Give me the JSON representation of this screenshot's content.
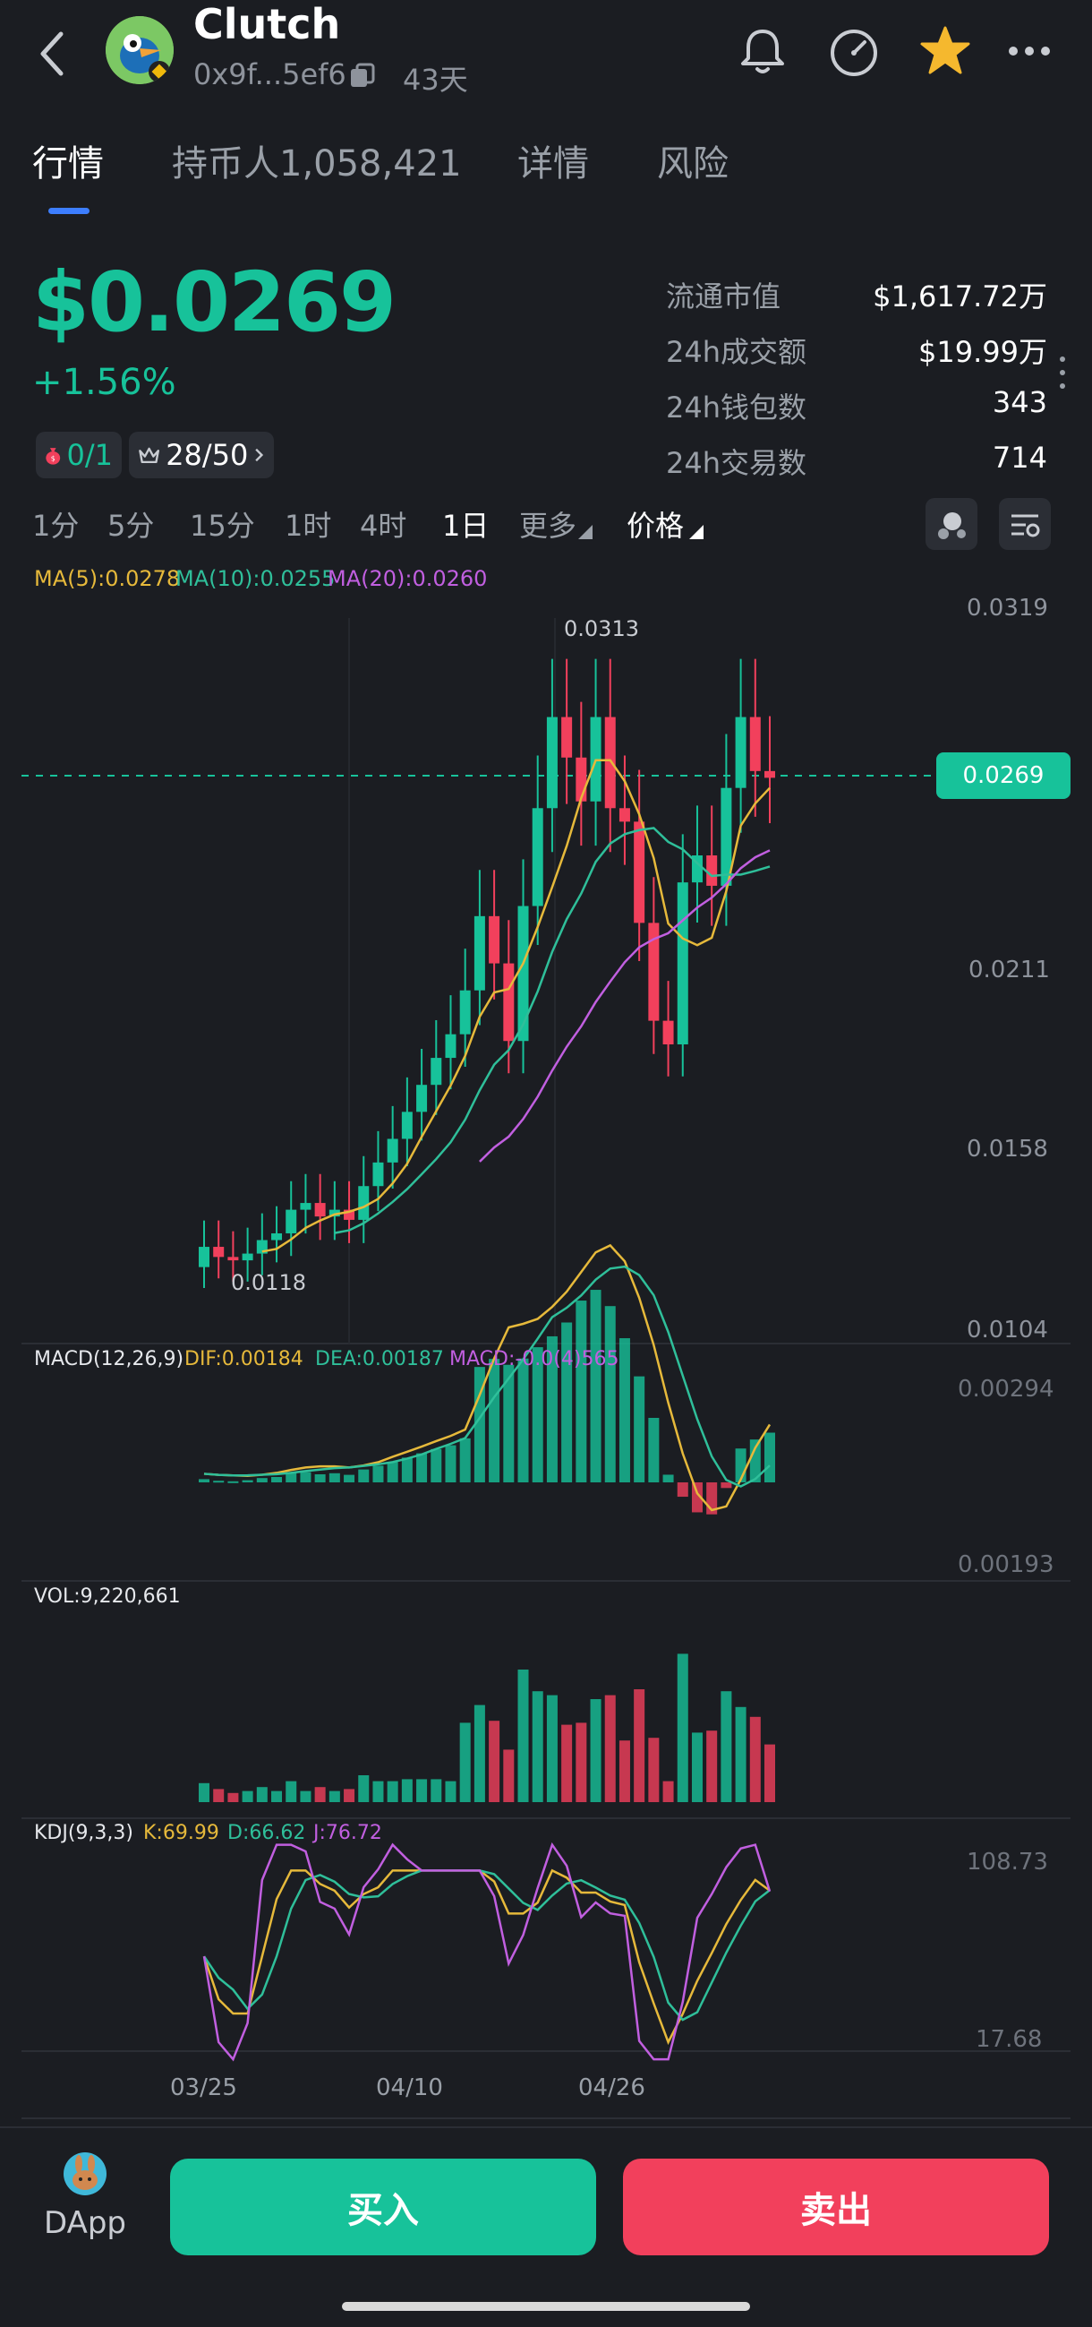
{
  "header": {
    "title": "Clutch",
    "address": "0x9f...5ef6",
    "age": "43天"
  },
  "tabs": [
    {
      "label": "行情"
    },
    {
      "label": "持币人1,058,421"
    },
    {
      "label": "详情"
    },
    {
      "label": "风险"
    }
  ],
  "price": "$0.0269",
  "change": "+1.56%",
  "chips": {
    "a": "0/1",
    "b": "28/50"
  },
  "stats": [
    {
      "label": "流通市值",
      "value": "$1,617.72万"
    },
    {
      "label": "24h成交额",
      "value": "$19.99万"
    },
    {
      "label": "24h钱包数",
      "value": "343"
    },
    {
      "label": "24h交易数",
      "value": "714"
    }
  ],
  "timeframes": [
    "1分",
    "5分",
    "15分",
    "1时",
    "4时",
    "1日",
    "更多",
    "价格"
  ],
  "ma_legend": {
    "ma5": "MA(5):0.0278",
    "ma10": "MA(10):0.0255",
    "ma20": "MA(20):0.0260"
  },
  "price_axis": [
    "0.0319",
    "0.0211",
    "0.0158",
    "0.0104"
  ],
  "current_price_tag": "0.0269",
  "high_label": "0.0313",
  "low_label": "0.0118",
  "macd": {
    "title": "MACD(12,26,9)",
    "dif": "DIF:0.00184",
    "dea": "DEA:0.00187",
    "macd": "MACD:-0.0(4)565",
    "top": "0.00294",
    "bottom": "0.00193"
  },
  "vol": {
    "title": "VOL:9,220,661"
  },
  "kdj": {
    "title": "KDJ(9,3,3)",
    "k": "K:69.99",
    "d": "D:66.62",
    "j": "J:76.72",
    "top": "108.73",
    "bottom": "17.68"
  },
  "dates": [
    "03/25",
    "04/10",
    "04/26"
  ],
  "buttons": {
    "dapp": "DApp",
    "buy": "买入",
    "sell": "卖出"
  },
  "colors": {
    "up": "#17c29a",
    "down": "#f2405c",
    "ma5": "#e6b93b",
    "ma10": "#2fbf9a",
    "ma20": "#c15fe0"
  },
  "chart_data": {
    "type": "candlestick",
    "opens": [
      0.0124,
      0.013,
      0.0127,
      0.0126,
      0.0128,
      0.0132,
      0.0134,
      0.0141,
      0.0143,
      0.0139,
      0.0141,
      0.0138,
      0.0148,
      0.0155,
      0.0162,
      0.017,
      0.0178,
      0.0186,
      0.0193,
      0.0206,
      0.0228,
      0.0214,
      0.0191,
      0.0231,
      0.026,
      0.0287,
      0.0275,
      0.0262,
      0.0287,
      0.026,
      0.0256,
      0.0226,
      0.0197,
      0.019,
      0.0238,
      0.0246,
      0.0237,
      0.0266,
      0.0287,
      0.0271
    ],
    "closes": [
      0.013,
      0.0127,
      0.0126,
      0.0128,
      0.0132,
      0.0134,
      0.0141,
      0.0143,
      0.0139,
      0.0141,
      0.0138,
      0.0148,
      0.0155,
      0.0162,
      0.017,
      0.0178,
      0.0186,
      0.0193,
      0.0206,
      0.0228,
      0.0214,
      0.0191,
      0.0231,
      0.026,
      0.0287,
      0.0275,
      0.0262,
      0.0287,
      0.026,
      0.0256,
      0.0226,
      0.0197,
      0.019,
      0.0238,
      0.0246,
      0.0237,
      0.0266,
      0.0287,
      0.0271,
      0.0269
    ],
    "volume_max": 9220661
  }
}
